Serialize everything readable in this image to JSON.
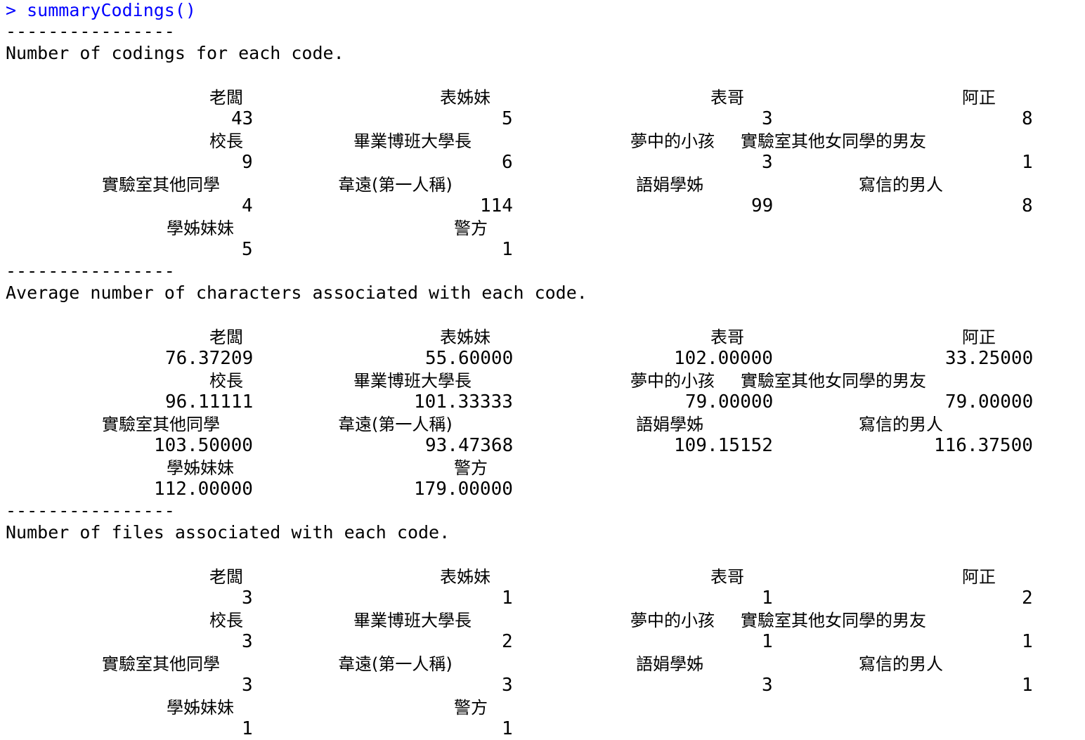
{
  "command": {
    "prompt": ">",
    "text": "summaryCodings()"
  },
  "sections": [
    {
      "rule": "----------------",
      "heading": "Number of codings for each code.",
      "rows": [
        {
          "labels": [
            "老闆",
            "表姊妹",
            "表哥",
            "阿正"
          ],
          "values": [
            "43",
            "5",
            "3",
            "8"
          ]
        },
        {
          "labels": [
            "校長",
            "畢業博班大學長",
            "夢中的小孩",
            "實驗室其他女同學的男友"
          ],
          "values": [
            "9",
            "6",
            "3",
            "1"
          ]
        },
        {
          "labels": [
            "實驗室其他同學",
            "韋遠(第一人稱)",
            "語娟學姊",
            "寫信的男人"
          ],
          "values": [
            "4",
            "114",
            "99",
            "8"
          ]
        },
        {
          "labels": [
            "學姊妹妹",
            "警方"
          ],
          "values": [
            "5",
            "1"
          ]
        }
      ]
    },
    {
      "rule": "----------------",
      "heading": "Average number of characters associated with each code.",
      "rows": [
        {
          "labels": [
            "老闆",
            "表姊妹",
            "表哥",
            "阿正"
          ],
          "values": [
            "76.37209",
            "55.60000",
            "102.00000",
            "33.25000"
          ]
        },
        {
          "labels": [
            "校長",
            "畢業博班大學長",
            "夢中的小孩",
            "實驗室其他女同學的男友"
          ],
          "values": [
            "96.11111",
            "101.33333",
            "79.00000",
            "79.00000"
          ]
        },
        {
          "labels": [
            "實驗室其他同學",
            "韋遠(第一人稱)",
            "語娟學姊",
            "寫信的男人"
          ],
          "values": [
            "103.50000",
            "93.47368",
            "109.15152",
            "116.37500"
          ]
        },
        {
          "labels": [
            "學姊妹妹",
            "警方"
          ],
          "values": [
            "112.00000",
            "179.00000"
          ]
        }
      ]
    },
    {
      "rule": "----------------",
      "heading": "Number of files associated with each code.",
      "rows": [
        {
          "labels": [
            "老闆",
            "表姊妹",
            "表哥",
            "阿正"
          ],
          "values": [
            "3",
            "1",
            "1",
            "2"
          ]
        },
        {
          "labels": [
            "校長",
            "畢業博班大學長",
            "夢中的小孩",
            "實驗室其他女同學的男友"
          ],
          "values": [
            "3",
            "2",
            "1",
            "1"
          ]
        },
        {
          "labels": [
            "實驗室其他同學",
            "韋遠(第一人稱)",
            "語娟學姊",
            "寫信的男人"
          ],
          "values": [
            "3",
            "3",
            "3",
            "1"
          ]
        },
        {
          "labels": [
            "學姊妹妹",
            "警方"
          ],
          "values": [
            "1",
            "1"
          ]
        }
      ]
    }
  ],
  "colors": {
    "prompt": "#0000ff",
    "text": "#000000",
    "background": "#ffffff"
  }
}
